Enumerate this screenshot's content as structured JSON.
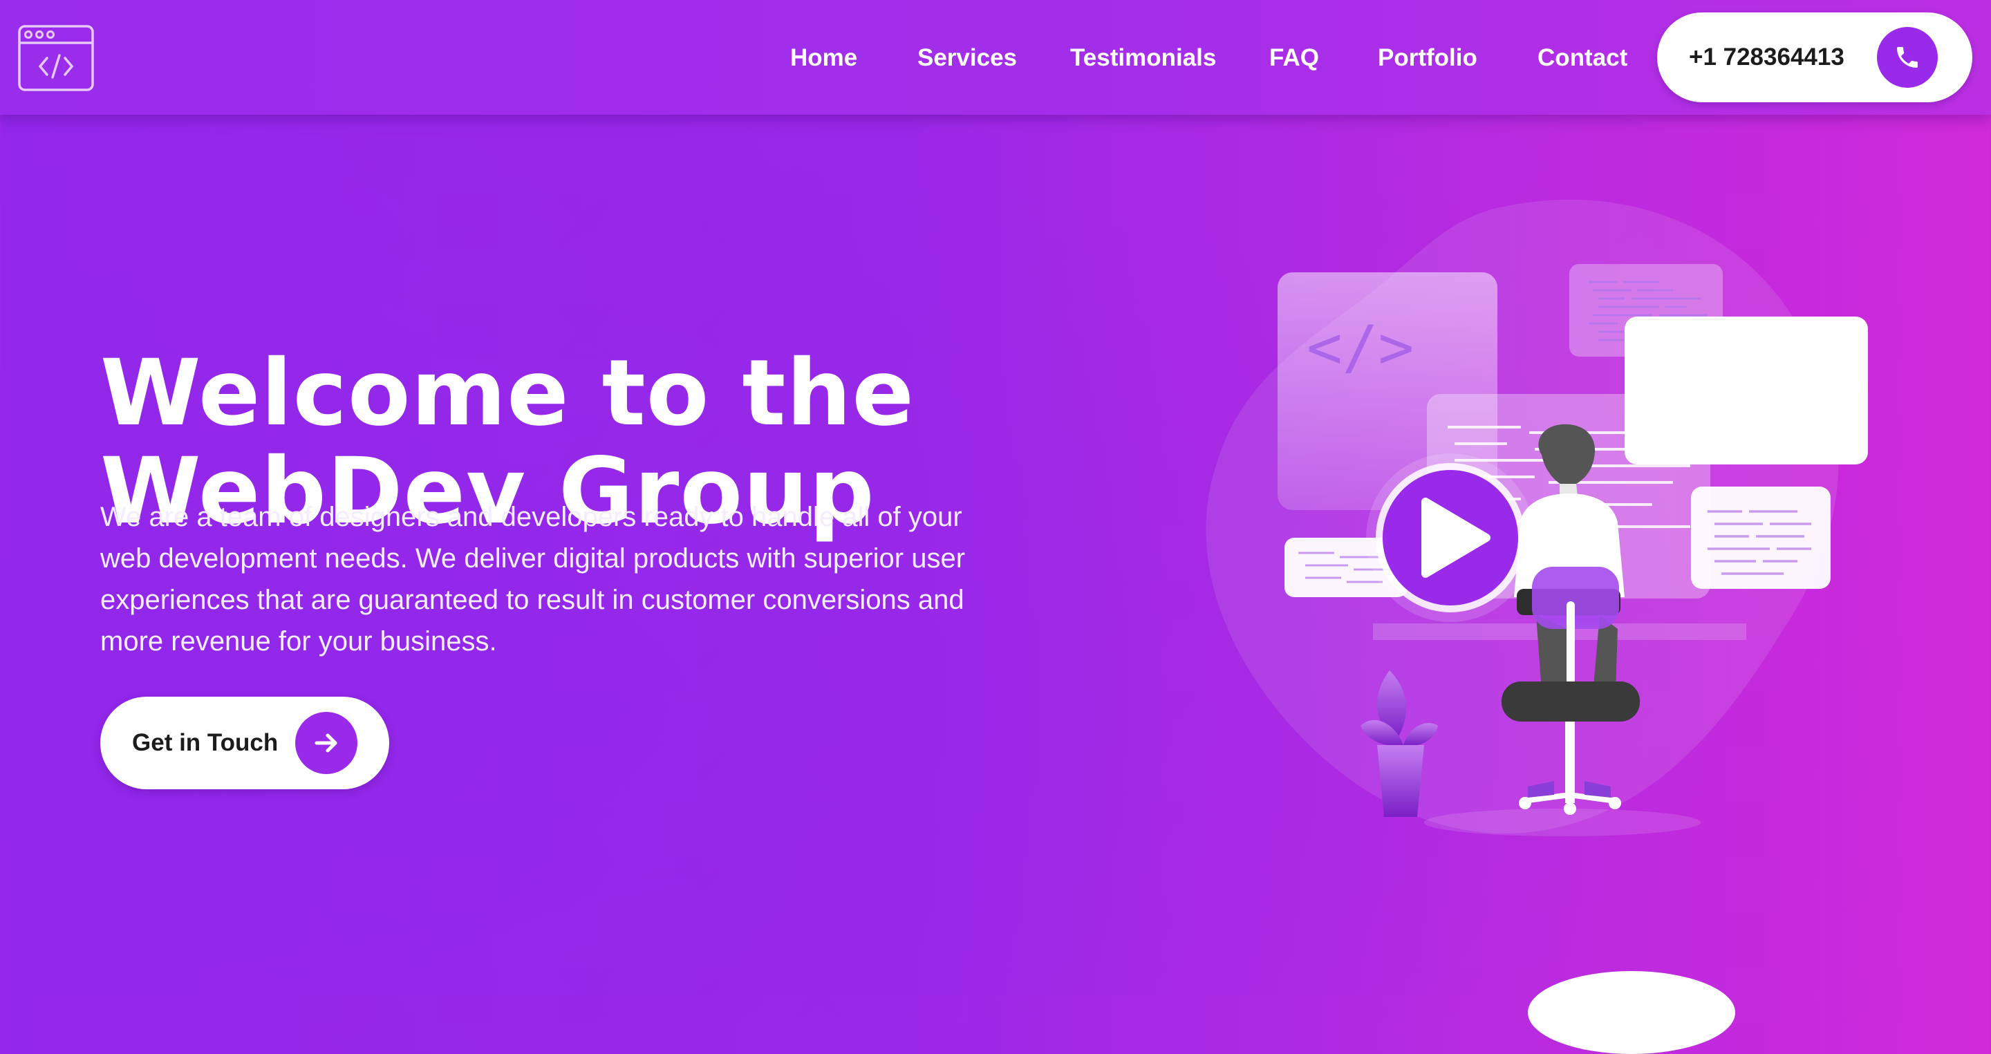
{
  "header": {
    "logo_icon": "code-window-icon",
    "nav": [
      {
        "label": "Home"
      },
      {
        "label": "Services"
      },
      {
        "label": "Testimonials"
      },
      {
        "label": "FAQ"
      },
      {
        "label": "Portfolio"
      },
      {
        "label": "Contact"
      }
    ],
    "phone": {
      "number": "+1 728364413",
      "icon": "phone-icon"
    }
  },
  "hero": {
    "title_line1": "Welcome to the",
    "title_line2": "WebDev Group",
    "description": "We are a team of designers and developers ready to handle all of your web development needs. We deliver digital products with superior user experiences that are guaranteed to result in customer conversions and more revenue for your business.",
    "cta": {
      "label": "Get in Touch",
      "icon": "arrow-right-icon"
    },
    "illustration": {
      "code_symbol": "</>",
      "play_icon": "play-icon"
    }
  },
  "colors": {
    "brand_purple": "#9a2ae9",
    "gradient_start": "#9327ea",
    "gradient_end": "#d02ad9",
    "text_dark": "#1c1c1c",
    "white": "#ffffff"
  }
}
